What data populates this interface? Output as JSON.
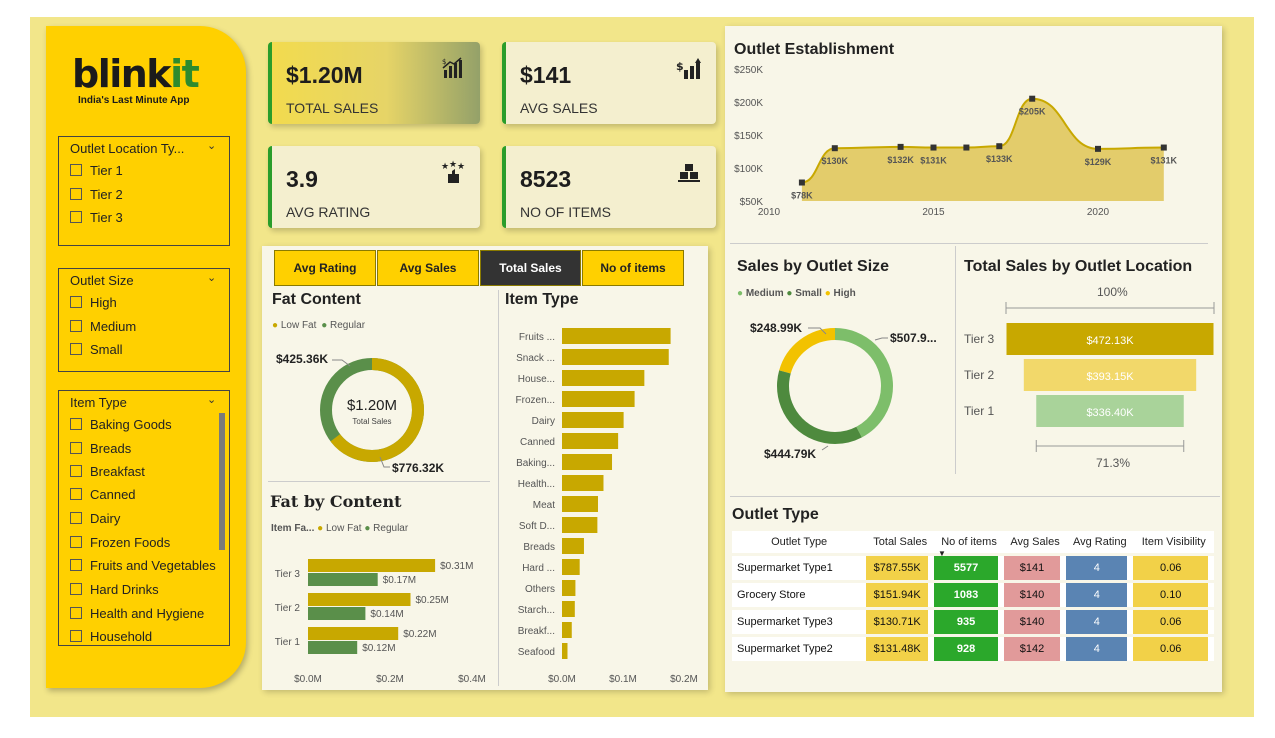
{
  "brand": {
    "logo_main": "blink",
    "logo_accent": "it",
    "tagline": "India's Last Minute App"
  },
  "filters": {
    "outlet_location": {
      "title": "Outlet Location Ty...",
      "options": [
        "Tier 1",
        "Tier 2",
        "Tier 3"
      ]
    },
    "outlet_size": {
      "title": "Outlet Size",
      "options": [
        "High",
        "Medium",
        "Small"
      ]
    },
    "item_type": {
      "title": "Item Type",
      "options": [
        "Baking Goods",
        "Breads",
        "Breakfast",
        "Canned",
        "Dairy",
        "Frozen Foods",
        "Fruits and Vegetables",
        "Hard Drinks",
        "Health and Hygiene",
        "Household"
      ]
    }
  },
  "kpis": [
    {
      "value": "$1.20M",
      "label": "TOTAL SALES",
      "icon": "sales-chart-icon"
    },
    {
      "value": "$141",
      "label": "AVG SALES",
      "icon": "dollar-growth-icon"
    },
    {
      "value": "3.9",
      "label": "AVG RATING",
      "icon": "rating-stars-icon"
    },
    {
      "value": "8523",
      "label": "NO OF ITEMS",
      "icon": "items-boxes-icon"
    }
  ],
  "tabs": [
    "Avg Rating",
    "Avg Sales",
    "Total Sales",
    "No of items"
  ],
  "active_tab": "Total Sales",
  "colors": {
    "low_fat": "#C8A800",
    "regular": "#5A8F4A",
    "gold": "#FFD000",
    "green_accent": "#2A9D2A"
  },
  "fat_content": {
    "title": "Fat Content",
    "legend": [
      "Low Fat",
      "Regular"
    ],
    "center_value": "$1.20M",
    "center_label": "Total Sales",
    "low_fat_label": "$776.32K",
    "regular_label": "$425.36K",
    "chart_data": {
      "type": "pie",
      "categories": [
        "Low Fat",
        "Regular"
      ],
      "values": [
        776.32,
        425.36
      ]
    }
  },
  "fat_by_content": {
    "title": "Fat by Content",
    "legend_title": "Item Fa...",
    "legend": [
      "Low Fat",
      "Regular"
    ],
    "chart_data": {
      "type": "bar",
      "categories": [
        "Tier 3",
        "Tier 2",
        "Tier 1"
      ],
      "series": [
        {
          "name": "Low Fat",
          "values": [
            0.31,
            0.25,
            0.22
          ]
        },
        {
          "name": "Regular",
          "values": [
            0.17,
            0.14,
            0.12
          ]
        }
      ],
      "low_labels": [
        "$0.31M",
        "$0.25M",
        "$0.22M"
      ],
      "reg_labels": [
        "$0.17M",
        "$0.14M",
        "$0.12M"
      ],
      "xticks": [
        "$0.0M",
        "$0.2M",
        "$0.4M"
      ],
      "xlim": [
        0,
        0.4
      ]
    }
  },
  "item_type_chart": {
    "title": "Item Type",
    "chart_data": {
      "type": "bar",
      "categories": [
        "Fruits ...",
        "Snack ...",
        "House...",
        "Frozen...",
        "Dairy",
        "Canned",
        "Baking...",
        "Health...",
        "Meat",
        "Soft D...",
        "Breads",
        "Hard ...",
        "Others",
        "Starch...",
        "Breakf...",
        "Seafood"
      ],
      "values": [
        0.178,
        0.175,
        0.135,
        0.119,
        0.101,
        0.092,
        0.082,
        0.068,
        0.059,
        0.058,
        0.036,
        0.029,
        0.022,
        0.021,
        0.016,
        0.009
      ],
      "xticks": [
        "$0.0M",
        "$0.1M",
        "$0.2M"
      ],
      "xlim": [
        0,
        0.2
      ]
    }
  },
  "outlet_establishment": {
    "title": "Outlet Establishment",
    "chart_data": {
      "type": "area",
      "x": [
        2011,
        2012,
        2014,
        2015,
        2016,
        2017,
        2018,
        2020,
        2022
      ],
      "values": [
        78,
        130,
        132,
        131,
        131,
        133,
        205,
        129,
        131
      ],
      "point_labels": [
        "$78K",
        "$130K",
        "$132K",
        "$131K",
        "",
        "$133K",
        "$205K",
        "$129K",
        "$131K"
      ],
      "yticks": [
        "$50K",
        "$100K",
        "$150K",
        "$200K",
        "$250K"
      ],
      "ylim": [
        50,
        250
      ],
      "xticks": [
        "2010",
        "2015",
        "2020"
      ],
      "xlim": [
        2010,
        2023
      ]
    }
  },
  "sales_by_size": {
    "title": "Sales by Outlet Size",
    "legend": [
      "Medium",
      "Small",
      "High"
    ],
    "labels": [
      "$507.9...",
      "$444.79K",
      "$248.99K"
    ],
    "chart_data": {
      "type": "pie",
      "categories": [
        "Medium",
        "Small",
        "High"
      ],
      "values": [
        507.9,
        444.79,
        248.99
      ]
    }
  },
  "sales_by_location": {
    "title": "Total Sales by Outlet Location",
    "top_pct": "100%",
    "bottom_pct": "71.3%",
    "chart_data": {
      "type": "bar",
      "categories": [
        "Tier 3",
        "Tier 2",
        "Tier 1"
      ],
      "values": [
        472.13,
        393.15,
        336.4
      ],
      "labels": [
        "$472.13K",
        "$393.15K",
        "$336.40K"
      ]
    }
  },
  "outlet_type": {
    "title": "Outlet Type",
    "headers": [
      "Outlet Type",
      "Total Sales",
      "No of items",
      "Avg Sales",
      "Avg Rating",
      "Item Visibility"
    ],
    "rows": [
      [
        "Supermarket Type1",
        "$787.55K",
        "5577",
        "$141",
        "4",
        "0.06"
      ],
      [
        "Grocery Store",
        "$151.94K",
        "1083",
        "$140",
        "4",
        "0.10"
      ],
      [
        "Supermarket Type3",
        "$130.71K",
        "935",
        "$140",
        "4",
        "0.06"
      ],
      [
        "Supermarket Type2",
        "$131.48K",
        "928",
        "$142",
        "4",
        "0.06"
      ]
    ]
  }
}
